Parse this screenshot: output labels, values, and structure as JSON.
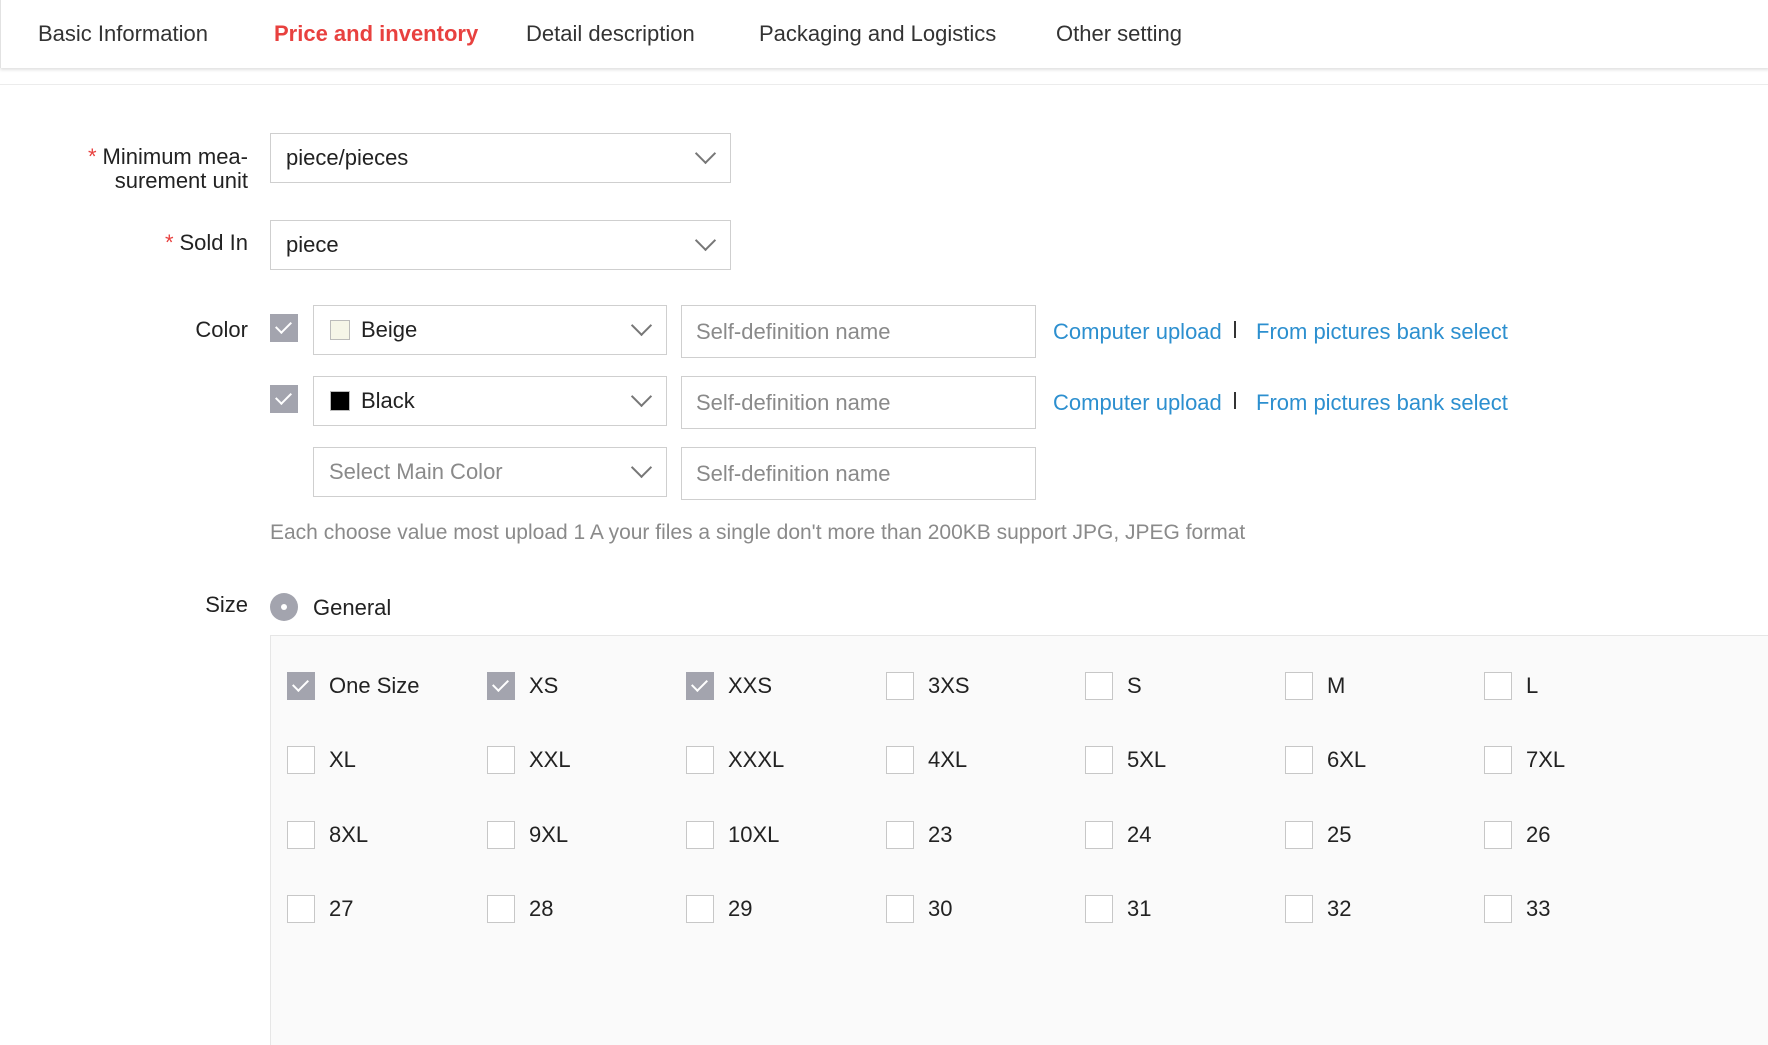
{
  "tabs": [
    {
      "label": "Basic Information",
      "active": false
    },
    {
      "label": "Price and inventory",
      "active": true
    },
    {
      "label": "Detail description",
      "active": false
    },
    {
      "label": "Packaging and Logistics",
      "active": false
    },
    {
      "label": "Other setting",
      "active": false
    }
  ],
  "form": {
    "required_mark": "*",
    "min_unit": {
      "label_line1": "Minimum mea-",
      "label_line2": "surement unit",
      "value": "piece/pieces"
    },
    "sold_in": {
      "label": "Sold In",
      "value": "piece"
    },
    "color": {
      "label": "Color",
      "rows": [
        {
          "checked": true,
          "value": "Beige",
          "swatch": "#f5f5e8",
          "name_placeholder": "Self-definition name",
          "upload_label": "Computer upload",
          "bank_label": "From pictures bank select"
        },
        {
          "checked": true,
          "value": "Black",
          "swatch": "#000000",
          "name_placeholder": "Self-definition name",
          "upload_label": "Computer upload",
          "bank_label": "From pictures bank select"
        },
        {
          "checked": false,
          "value": "Select Main Color",
          "swatch": "",
          "name_placeholder": "Self-definition name"
        }
      ],
      "hint": "Each choose value most upload 1 A your files a single don't more than 200KB support JPG, JPEG format"
    },
    "size": {
      "label": "Size",
      "mode": "General",
      "items": [
        {
          "label": "One Size",
          "checked": true
        },
        {
          "label": "XS",
          "checked": true
        },
        {
          "label": "XXS",
          "checked": true
        },
        {
          "label": "3XS",
          "checked": false
        },
        {
          "label": "S",
          "checked": false
        },
        {
          "label": "M",
          "checked": false
        },
        {
          "label": "L",
          "checked": false
        },
        {
          "label": "XL",
          "checked": false
        },
        {
          "label": "XXL",
          "checked": false
        },
        {
          "label": "XXXL",
          "checked": false
        },
        {
          "label": "4XL",
          "checked": false
        },
        {
          "label": "5XL",
          "checked": false
        },
        {
          "label": "6XL",
          "checked": false
        },
        {
          "label": "7XL",
          "checked": false
        },
        {
          "label": "8XL",
          "checked": false
        },
        {
          "label": "9XL",
          "checked": false
        },
        {
          "label": "10XL",
          "checked": false
        },
        {
          "label": "23",
          "checked": false
        },
        {
          "label": "24",
          "checked": false
        },
        {
          "label": "25",
          "checked": false
        },
        {
          "label": "26",
          "checked": false
        },
        {
          "label": "27",
          "checked": false
        },
        {
          "label": "28",
          "checked": false
        },
        {
          "label": "29",
          "checked": false
        },
        {
          "label": "30",
          "checked": false
        },
        {
          "label": "31",
          "checked": false
        },
        {
          "label": "32",
          "checked": false
        },
        {
          "label": "33",
          "checked": false
        }
      ]
    }
  },
  "colors": {
    "accent": "#e8413f",
    "link": "#2c8fcf",
    "checkbox_on": "#a3a4ae",
    "placeholder": "#8a8a8a"
  }
}
